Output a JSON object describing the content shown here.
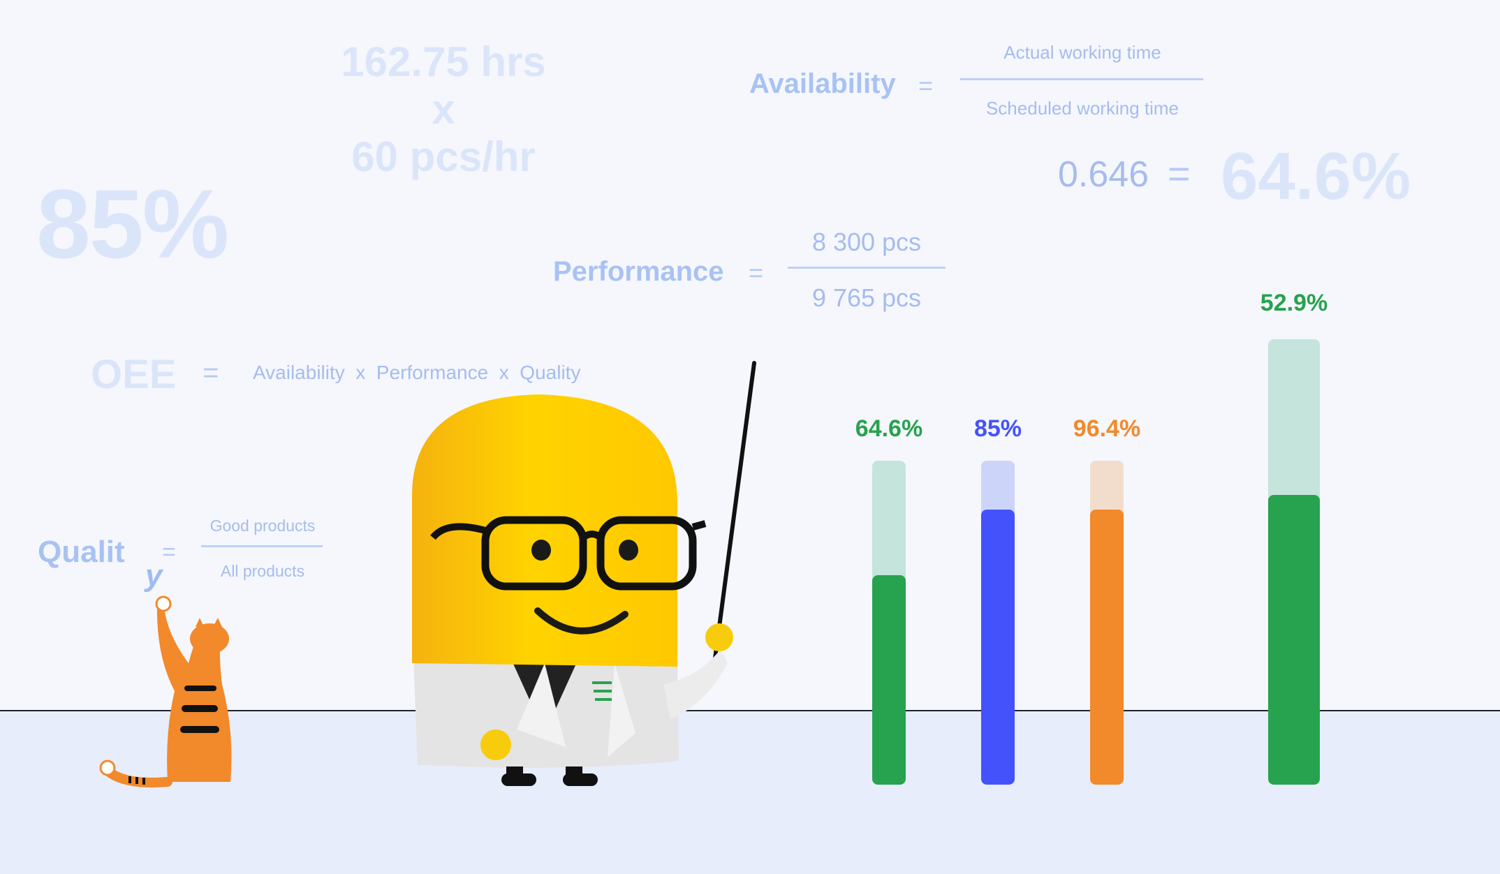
{
  "big_percent": "85%",
  "hours_line1": "162.75 hrs",
  "hours_line2": "x",
  "hours_line3": "60 pcs/hr",
  "availability": {
    "label": "Availability",
    "equals": "=",
    "numerator": "Actual working time",
    "denominator": "Scheduled working time",
    "result_value": "0.646",
    "result_equals": "=",
    "result_percent": "64.6%"
  },
  "performance": {
    "label": "Performance",
    "equals": "=",
    "numerator": "8 300 pcs",
    "denominator": "9 765 pcs"
  },
  "oee": {
    "label": "OEE",
    "equals": "=",
    "formula": "Availability  x  Performance  x  Quality"
  },
  "quality": {
    "label_main": "Qualit",
    "label_tail": "y",
    "equals": "=",
    "numerator": "Good products",
    "denominator": "All products"
  },
  "bars": [
    {
      "label": "64.6%",
      "value": 0.646,
      "color": "#27a24e",
      "track": "#c5e4db"
    },
    {
      "label": "85%",
      "value": 0.85,
      "color": "#4452fb",
      "track": "#ccd5f9"
    },
    {
      "label": "96.4%",
      "value": 0.85,
      "color": "#f2892a",
      "track": "#f2ddcc"
    },
    {
      "label": "52.9%",
      "value": 0.65,
      "color": "#27a24e",
      "track": "#c5e4db"
    }
  ]
}
